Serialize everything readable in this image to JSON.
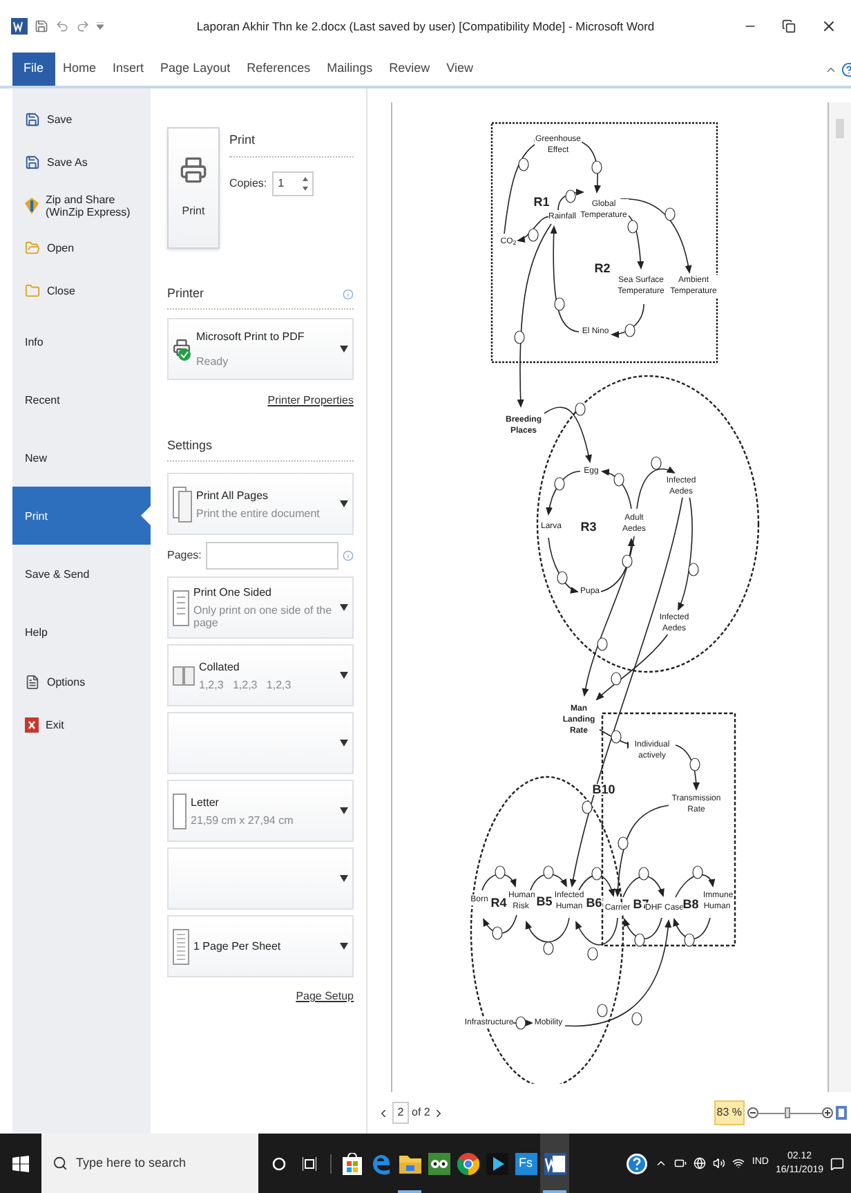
{
  "window": {
    "title": "Laporan Akhir Thn ke 2.docx (Last saved by user) [Compatibility Mode] - Microsoft Word"
  },
  "ribbon_tabs": [
    {
      "label": "File",
      "selected": true
    },
    {
      "label": "Home",
      "selected": false
    },
    {
      "label": "Insert",
      "selected": false
    },
    {
      "label": "Page Layout",
      "selected": false
    },
    {
      "label": "References",
      "selected": false
    },
    {
      "label": "Mailings",
      "selected": false
    },
    {
      "label": "Review",
      "selected": false
    },
    {
      "label": "View",
      "selected": false
    }
  ],
  "nav": [
    {
      "label": "Save",
      "kind": "save",
      "selected": false
    },
    {
      "label": "Save As",
      "kind": "save_as",
      "selected": false
    },
    {
      "label": "Zip and Share (WinZip Express)",
      "kind": "zip",
      "selected": false
    },
    {
      "label": "Open",
      "kind": "open",
      "selected": false
    },
    {
      "label": "Close",
      "kind": "close",
      "selected": false
    },
    {
      "label": "Info",
      "kind": "page",
      "selected": false
    },
    {
      "label": "Recent",
      "kind": "page",
      "selected": false
    },
    {
      "label": "New",
      "kind": "page",
      "selected": false
    },
    {
      "label": "Print",
      "kind": "page",
      "selected": true
    },
    {
      "label": "Save & Send",
      "kind": "page",
      "selected": false
    },
    {
      "label": "Help",
      "kind": "page",
      "selected": false
    },
    {
      "label": "Options",
      "kind": "options",
      "selected": false
    },
    {
      "label": "Exit",
      "kind": "exit",
      "selected": false
    }
  ],
  "print": {
    "heading": "Print",
    "button": "Print",
    "copies_label": "Copies:",
    "copies": "1"
  },
  "printer": {
    "heading": "Printer",
    "name": "Microsoft Print to PDF",
    "status": "Ready",
    "link": "Printer Properties"
  },
  "settings": {
    "heading": "Settings",
    "pages_label": "Pages:",
    "link": "Page Setup",
    "options": [
      {
        "kind": "print_range",
        "title": "Print All Pages",
        "subtitle": "Print the entire document"
      },
      {
        "kind": "pages"
      },
      {
        "kind": "sides",
        "title": "Print One Sided",
        "subtitle": "Only print on one side of the page"
      },
      {
        "kind": "collation",
        "title": "Collated",
        "subtitle": "1,2,3   1,2,3   1,2,3"
      },
      {
        "kind": "blank"
      },
      {
        "kind": "paper",
        "title": "Letter",
        "subtitle": "21,59 cm x 27,94 cm"
      },
      {
        "kind": "blank"
      },
      {
        "kind": "per_sheet",
        "title": "1 Page Per Sheet"
      }
    ]
  },
  "diagram": {
    "nodes": [
      {
        "label": "Greenhouse Effect",
        "kind": "variable"
      },
      {
        "label": "R1",
        "kind": "loop"
      },
      {
        "label": "Global Temperature",
        "kind": "variable"
      },
      {
        "label": "CO$_{2}$",
        "kind": "variable"
      },
      {
        "label": "Rainfall",
        "kind": "variable"
      },
      {
        "label": "R2",
        "kind": "loop"
      },
      {
        "label": "Sea Surface Temperature",
        "kind": "variable"
      },
      {
        "label": "Ambient Temperature",
        "kind": "variable"
      },
      {
        "label": "El Nino",
        "kind": "variable"
      },
      {
        "label": "Breeding Places",
        "kind": "key"
      },
      {
        "label": "Egg",
        "kind": "variable"
      },
      {
        "label": "Infected Aedes",
        "kind": "variable"
      },
      {
        "label": "Larva",
        "kind": "variable"
      },
      {
        "label": "R3",
        "kind": "loop"
      },
      {
        "label": "Adult Aedes",
        "kind": "variable"
      },
      {
        "label": "Pupa",
        "kind": "variable"
      },
      {
        "label": "Infected Aedes",
        "kind": "variable"
      },
      {
        "label": "Man Landing Rate",
        "kind": "key"
      },
      {
        "label": "Individual actively",
        "kind": "variable"
      },
      {
        "label": "B10",
        "kind": "loop"
      },
      {
        "label": "Transmission Rate",
        "kind": "variable"
      },
      {
        "label": "Born",
        "kind": "variable"
      },
      {
        "label": "R4",
        "kind": "loop"
      },
      {
        "label": "Human Risk",
        "kind": "variable"
      },
      {
        "label": "B5",
        "kind": "loop"
      },
      {
        "label": "Infected Human",
        "kind": "variable"
      },
      {
        "label": "B6",
        "kind": "loop"
      },
      {
        "label": "Carrier",
        "kind": "variable"
      },
      {
        "label": "B7",
        "kind": "loop"
      },
      {
        "label": "DHF Case",
        "kind": "variable"
      },
      {
        "label": "B8",
        "kind": "loop"
      },
      {
        "label": "Immune Human",
        "kind": "variable"
      },
      {
        "label": "Infrastructure",
        "kind": "variable"
      },
      {
        "label": "Mobility",
        "kind": "variable"
      }
    ]
  },
  "pager": {
    "current": "2",
    "total": "of 2"
  },
  "zoom": {
    "label": "83 %",
    "level": 0.45
  },
  "taskbar": {
    "search_placeholder": "Type here to search",
    "apps": [
      {
        "kind": "store",
        "running": false,
        "selected": false
      },
      {
        "kind": "edge",
        "running": false,
        "selected": false
      },
      {
        "kind": "explorer",
        "running": true,
        "selected": false
      },
      {
        "kind": "tripadvisor",
        "running": false,
        "selected": false
      },
      {
        "kind": "chrome",
        "running": false,
        "selected": false
      },
      {
        "kind": "media",
        "running": false,
        "selected": false
      },
      {
        "kind": "fs",
        "label": "Fs",
        "running": false,
        "selected": false
      },
      {
        "kind": "word",
        "running": true,
        "selected": true
      }
    ],
    "language": "IND",
    "time": "02.12",
    "date": "16/11/2019"
  }
}
